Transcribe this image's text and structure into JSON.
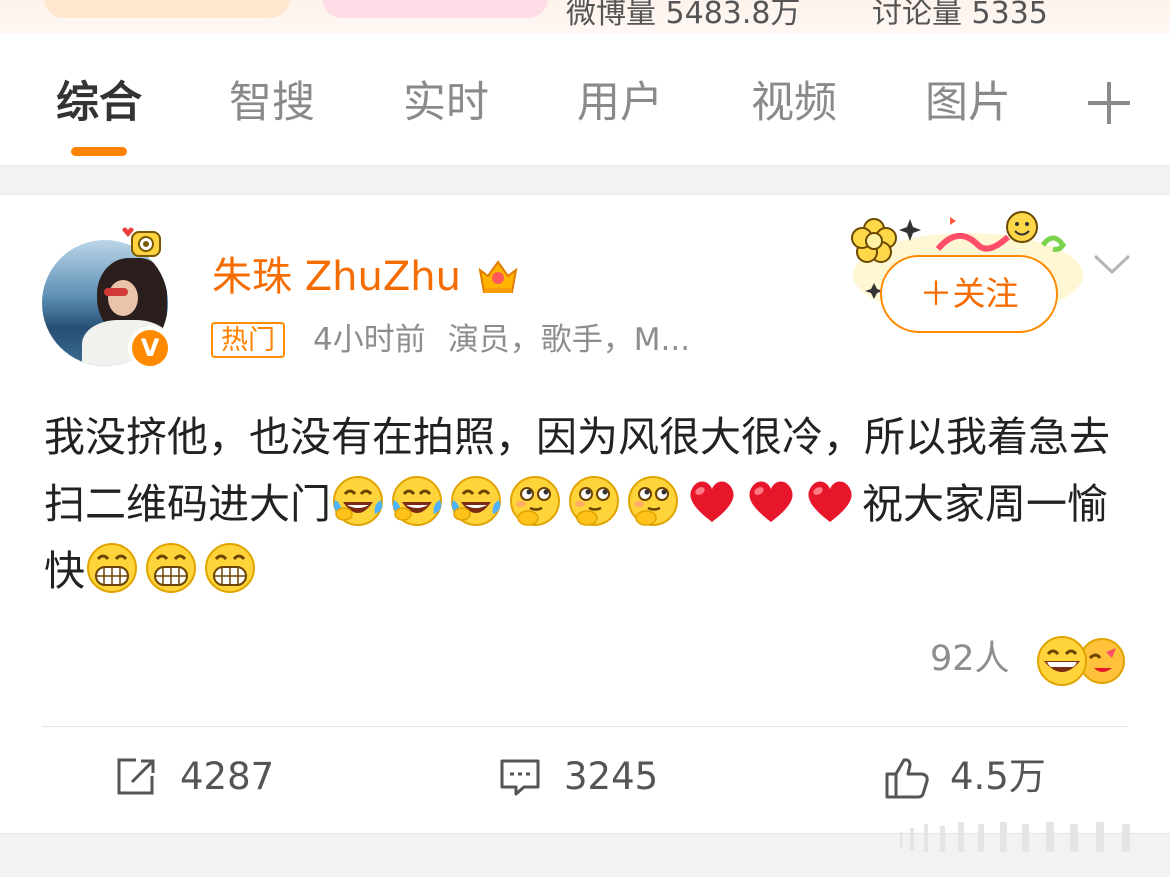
{
  "top": {
    "stat1": "微博量 5483.8万",
    "stat2": "讨论量 5335"
  },
  "tabs": [
    {
      "label": "综合",
      "active": true
    },
    {
      "label": "智搜"
    },
    {
      "label": "实时"
    },
    {
      "label": "用户"
    },
    {
      "label": "视频"
    },
    {
      "label": "图片"
    }
  ],
  "post": {
    "username": "朱珠 ZhuZhu",
    "hot_badge": "热门",
    "time": "4小时前",
    "description": "演员，歌手，M...",
    "follow_label": "＋关注",
    "verified_glyph": "V",
    "text_part1": "我没挤他，也没有在拍照，因为风很大很冷，所以我着急去扫二维码进大门",
    "text_part2": "祝大家周一愉快",
    "emoji_row1": [
      "laugh-cry-emoji",
      "laugh-cry-emoji",
      "laugh-cry-emoji",
      "thinking-emoji",
      "thinking-emoji",
      "thinking-emoji",
      "heart-emoji",
      "heart-emoji",
      "heart-emoji"
    ],
    "emoji_row2": [
      "grin-emoji",
      "grin-emoji",
      "grin-emoji"
    ],
    "likers_label": "92人",
    "repost_count": "4287",
    "comment_count": "3245",
    "like_count": "4.5万"
  },
  "colors": {
    "accent": "#ff8200",
    "username": "#f56c00",
    "muted": "#8d8d8d"
  }
}
